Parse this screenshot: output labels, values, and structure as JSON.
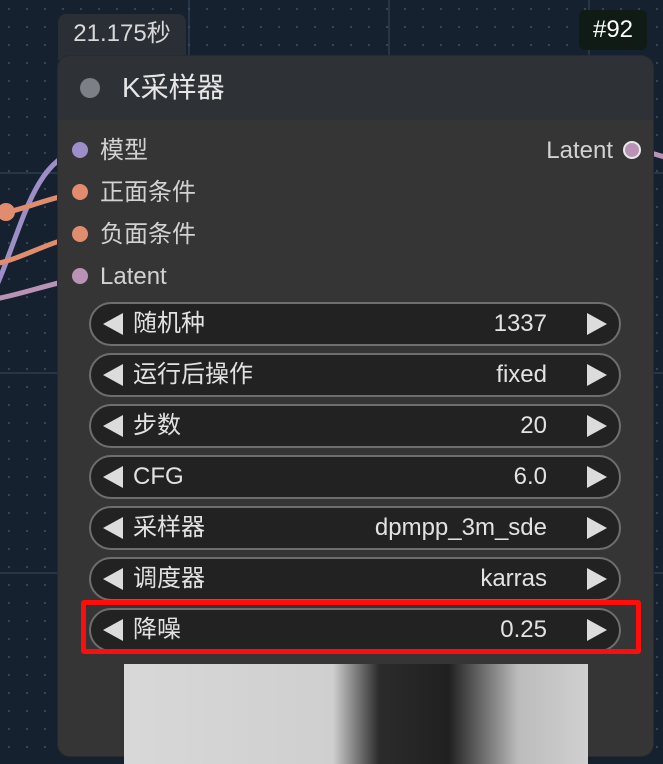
{
  "timing": {
    "label": "21.175秒"
  },
  "node_id": {
    "label": "#92"
  },
  "node": {
    "title": "K采样器",
    "inputs": [
      {
        "label": "模型",
        "color": "#9d8ec8"
      },
      {
        "label": "正面条件",
        "color": "#e08c6e"
      },
      {
        "label": "负面条件",
        "color": "#e08c6e"
      },
      {
        "label": "Latent",
        "color": "#b993b6"
      }
    ],
    "outputs": [
      {
        "label": "Latent",
        "color": "#b993b6"
      }
    ],
    "widgets": [
      {
        "label": "随机种",
        "value": "1337"
      },
      {
        "label": "运行后操作",
        "value": "fixed"
      },
      {
        "label": "步数",
        "value": "20"
      },
      {
        "label": "CFG",
        "value": "6.0"
      },
      {
        "label": "采样器",
        "value": "dpmpp_3m_sde"
      },
      {
        "label": "调度器",
        "value": "karras"
      },
      {
        "label": "降噪",
        "value": "0.25"
      }
    ]
  },
  "highlight_color": "#ff0d0d"
}
